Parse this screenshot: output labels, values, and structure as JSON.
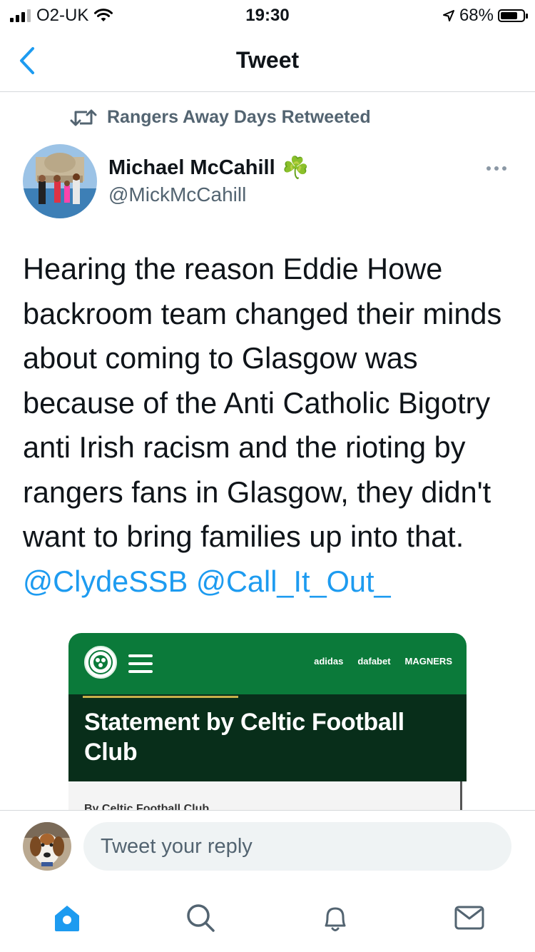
{
  "status_bar": {
    "carrier": "O2-UK",
    "time": "19:30",
    "battery": "68%",
    "battery_level": 0.68
  },
  "nav": {
    "title": "Tweet"
  },
  "retweet_banner": {
    "text": "Rangers Away Days Retweeted"
  },
  "author": {
    "name": "Michael McCahill",
    "name_emoji": "☘️",
    "handle": "@MickMcCahill"
  },
  "tweet": {
    "lines": [
      "Hearing the reason Eddie Howe",
      "backroom team changed their minds",
      "about coming to Glasgow was",
      "because of the Anti Catholic Bigotry",
      "anti Irish racism and the rioting by",
      "rangers fans in Glasgow, they didn't",
      "want to bring families up into that."
    ],
    "mentions": [
      "@ClydeSSB",
      "@Call_It_Out_"
    ]
  },
  "embedded_image": {
    "sponsors": [
      "adidas",
      "dafabet",
      "MAGNERS"
    ],
    "headline": "Statement by Celtic Football Club",
    "byline": "By Celtic Football Club"
  },
  "reply": {
    "placeholder": "Tweet your reply"
  },
  "tab_bar": {
    "items": [
      "home-icon",
      "search-icon",
      "notifications-icon",
      "messages-icon"
    ],
    "active_color": "#1d9bf0"
  },
  "colors": {
    "accent": "#1d9bf0",
    "celtic_green": "#0b7a3a"
  }
}
